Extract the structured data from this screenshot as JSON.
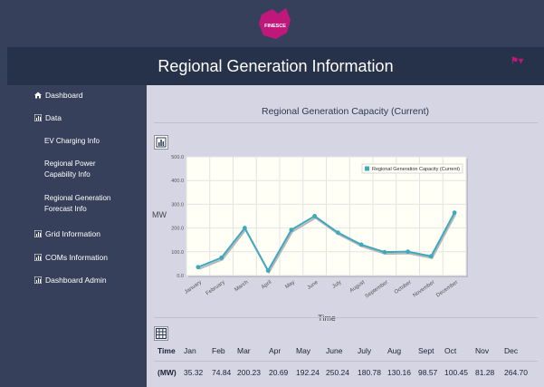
{
  "brand": {
    "logo_text": "FINESCE",
    "logo_color": "#c0187a"
  },
  "header": {
    "title": "Regional Generation Information",
    "user_icon": "user-icon"
  },
  "sidebar": {
    "items": [
      {
        "label": "Dashboard",
        "icon": "home-icon"
      },
      {
        "label": "Data",
        "icon": "chart-icon"
      },
      {
        "label": "EV Charging Info"
      },
      {
        "label": "Regional Power Capability Info"
      },
      {
        "label": "Regional Generation Forecast Info"
      },
      {
        "label": "Grid Information",
        "icon": "chart-icon"
      },
      {
        "label": "COMs Information",
        "icon": "chart-icon"
      },
      {
        "label": "Dashboard Admin",
        "icon": "chart-icon"
      }
    ]
  },
  "main": {
    "title": "Regional Generation Capacity (Current)"
  },
  "chart_data": {
    "type": "line",
    "categories": [
      "January",
      "February",
      "March",
      "April",
      "May",
      "June",
      "July",
      "August",
      "September",
      "October",
      "November",
      "December"
    ],
    "series": [
      {
        "name": "Regional Generation Capacity (Current)",
        "values": [
          35.32,
          74.84,
          200.23,
          20.69,
          192.24,
          250.24,
          180.78,
          130.16,
          98.57,
          100.45,
          81.28,
          264.7
        ],
        "color": "#3ea8bf"
      }
    ],
    "ylim": [
      0,
      500
    ],
    "yticks": [
      "0.0",
      "100.0",
      "200.0",
      "300.0",
      "400.0",
      "500.0"
    ],
    "ylabel": "MW",
    "xlabel": "Time",
    "grid": true,
    "legend_position": "top-right"
  },
  "table": {
    "headers": [
      "Time",
      "Jan",
      "Feb",
      "Mar",
      "Apr",
      "May",
      "June",
      "July",
      "Aug",
      "Sept",
      "Oct",
      "Nov",
      "Dec"
    ],
    "values": [
      "(MW)",
      "35.32",
      "74.84",
      "200.23",
      "20.69",
      "192.24",
      "250.24",
      "180.78",
      "130.16",
      "98.57",
      "100.45",
      "81.28",
      "264.70"
    ]
  }
}
